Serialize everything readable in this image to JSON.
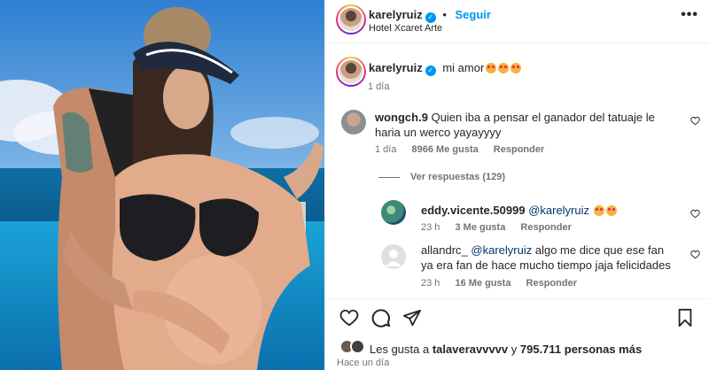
{
  "post": {
    "username": "karelyruiz",
    "follow_label": "Seguir",
    "location": "Hotel Xcaret Arte",
    "more_label": "•••",
    "caption_text": "mi amor",
    "caption_time": "1 día"
  },
  "comments": [
    {
      "username": "wongch.9",
      "text": "Quien iba a pensar el ganador del tatuaje le haria un werco yayayyyy",
      "time": "1 día",
      "likes": "8966 Me gusta",
      "reply_label": "Responder",
      "view_replies": "Ver respuestas (129)"
    }
  ],
  "replies": [
    {
      "username": "eddy.vicente.50999",
      "mention": "@karelyruiz",
      "time": "23 h",
      "likes": "3 Me gusta",
      "reply_label": "Responder"
    },
    {
      "username": "allandrc_",
      "mention": "@karelyruiz",
      "text": "algo me dice que ese fan ya era fan de hace mucho tiempo jaja felicidades",
      "time": "23 h",
      "likes": "16 Me gusta",
      "reply_label": "Responder"
    }
  ],
  "footer": {
    "likes_prefix": "Les gusta a ",
    "likes_user": "talaveravvvvv",
    "likes_middle": " y ",
    "likes_count": "795.711 personas más",
    "time_ago": "Hace un día"
  },
  "icons": {
    "like": "heart-icon",
    "comment": "comment-icon",
    "share": "send-icon",
    "save": "bookmark-icon"
  },
  "colors": {
    "accent": "#0095f6",
    "muted": "#737373",
    "text": "#262626"
  }
}
